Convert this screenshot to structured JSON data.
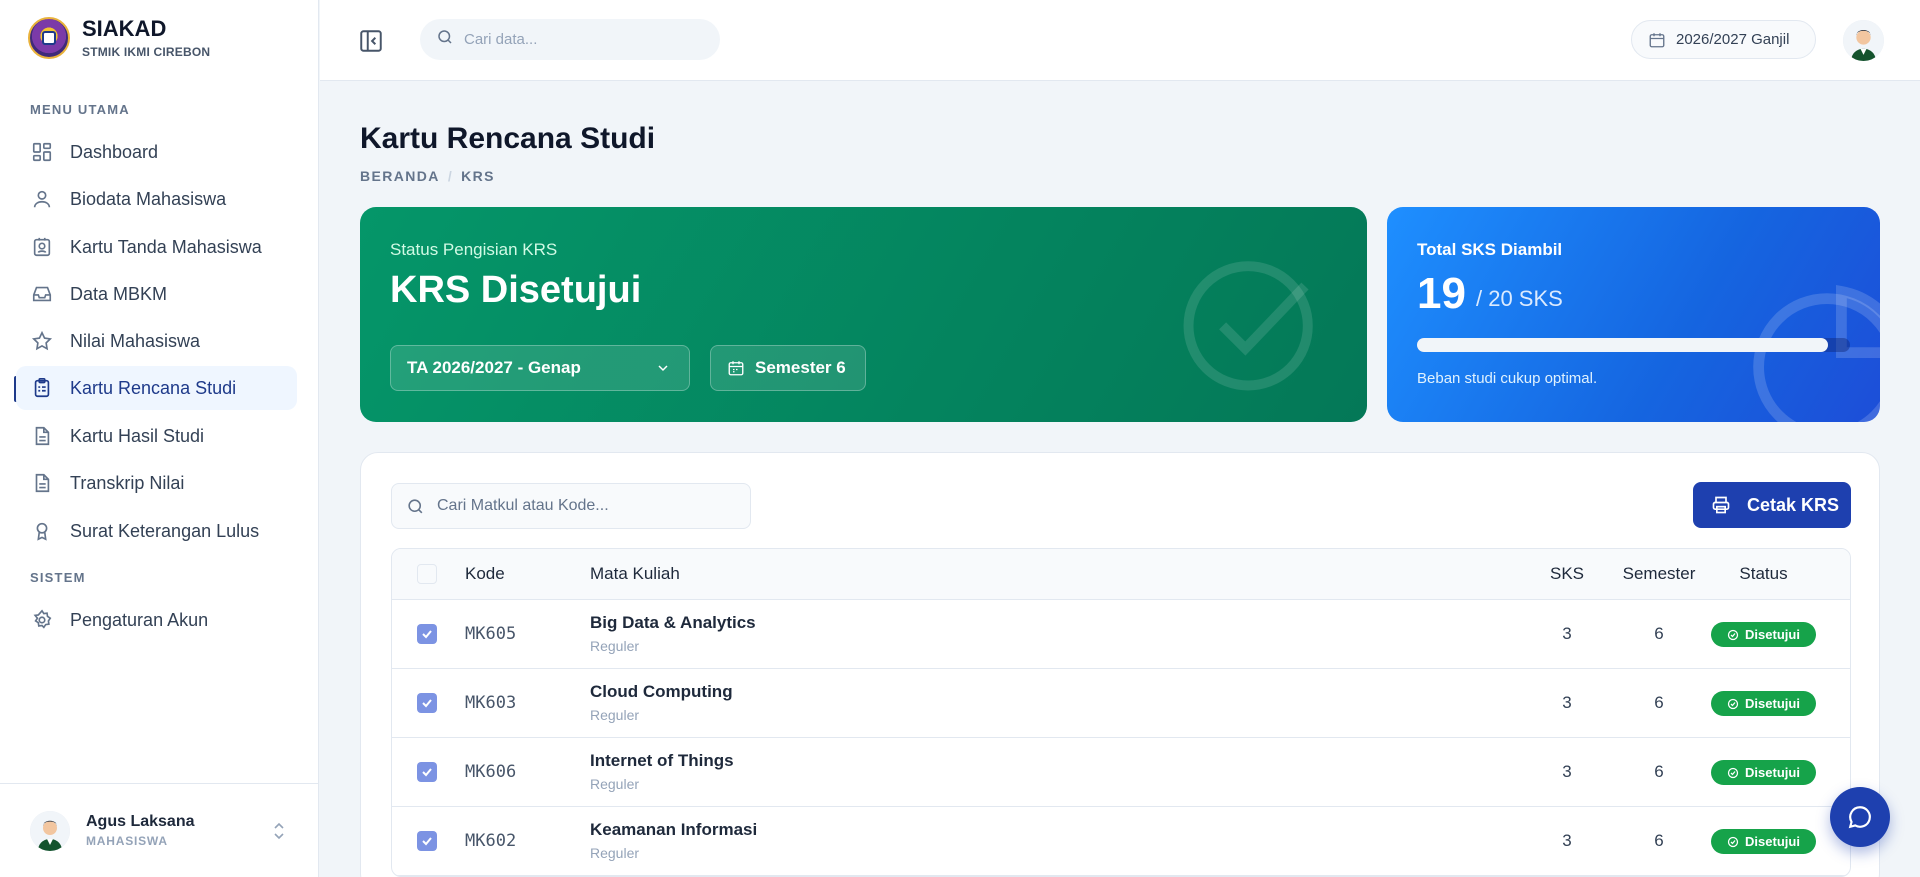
{
  "brand": {
    "title": "SIAKAD",
    "subtitle": "STMIK IKMI CIREBON"
  },
  "sidebar": {
    "section_main": "MENU UTAMA",
    "section_system": "SISTEM",
    "items": [
      {
        "label": "Dashboard",
        "icon": "grid-icon"
      },
      {
        "label": "Biodata Mahasiswa",
        "icon": "user-icon"
      },
      {
        "label": "Kartu Tanda Mahasiswa",
        "icon": "id-card-icon"
      },
      {
        "label": "Data MBKM",
        "icon": "inbox-icon"
      },
      {
        "label": "Nilai Mahasiswa",
        "icon": "star-icon"
      },
      {
        "label": "Kartu Rencana Studi",
        "icon": "clipboard-icon",
        "active": true
      },
      {
        "label": "Kartu Hasil Studi",
        "icon": "document-icon"
      },
      {
        "label": "Transkrip Nilai",
        "icon": "document-icon"
      },
      {
        "label": "Surat Keterangan Lulus",
        "icon": "award-icon"
      }
    ],
    "system_items": [
      {
        "label": "Pengaturan Akun",
        "icon": "gear-icon"
      }
    ],
    "user": {
      "name": "Agus Laksana",
      "role": "MAHASISWA"
    }
  },
  "header": {
    "search_placeholder": "Cari data...",
    "academic_year": "2026/2027 Ganjil"
  },
  "page": {
    "title": "Kartu Rencana Studi",
    "breadcrumb": [
      "BERANDA",
      "KRS"
    ]
  },
  "status_card": {
    "label": "Status Pengisian KRS",
    "value": "KRS Disetujui",
    "year_select": "TA 2026/2027 - Genap",
    "semester": "Semester 6",
    "accent": "#059669"
  },
  "sks_card": {
    "label": "Total SKS Diambil",
    "taken": "19",
    "of": "/ 20 SKS",
    "progress_fraction": 0.95,
    "note": "Beban studi cukup optimal.",
    "accent": "#1565e0"
  },
  "table": {
    "search_placeholder": "Cari Matkul atau Kode...",
    "print_label": "Cetak KRS",
    "headers": {
      "code": "Kode",
      "name": "Mata Kuliah",
      "sks": "SKS",
      "semester": "Semester",
      "status": "Status"
    },
    "rows": [
      {
        "code": "MK605",
        "name": "Big Data & Analytics",
        "type": "Reguler",
        "sks": "3",
        "semester": "6",
        "status": "Disetujui"
      },
      {
        "code": "MK603",
        "name": "Cloud Computing",
        "type": "Reguler",
        "sks": "3",
        "semester": "6",
        "status": "Disetujui"
      },
      {
        "code": "MK606",
        "name": "Internet of Things",
        "type": "Reguler",
        "sks": "3",
        "semester": "6",
        "status": "Disetujui"
      },
      {
        "code": "MK602",
        "name": "Keamanan Informasi",
        "type": "Reguler",
        "sks": "3",
        "semester": "6",
        "status": "Disetujui"
      }
    ]
  }
}
